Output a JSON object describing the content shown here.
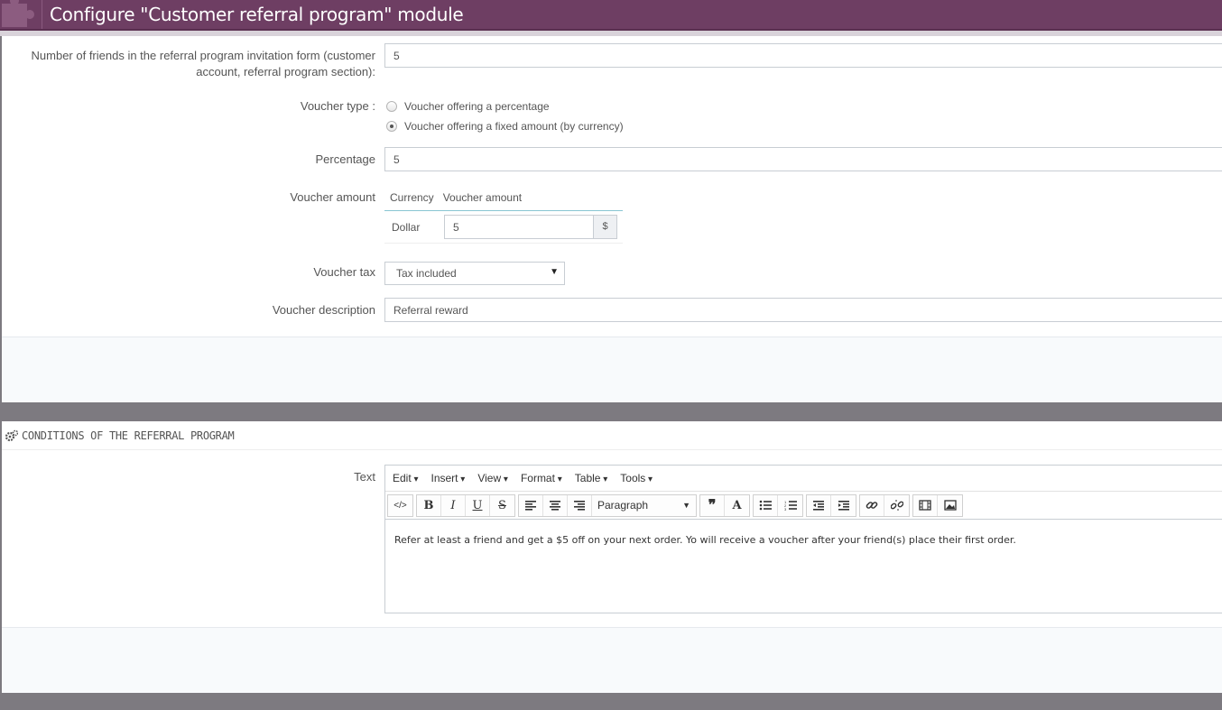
{
  "header": {
    "title": "Configure \"Customer referral program\" module"
  },
  "form": {
    "friends_label": "Number of friends in the referral program invitation form (customer account, referral program section):",
    "friends_label_line1": "Number of friends in the referral program invitation form (customer",
    "friends_label_line2": "account, referral program section):",
    "friends_value": "5",
    "voucher_type_label": "Voucher type :",
    "voucher_type_options": [
      "Voucher offering a percentage",
      "Voucher offering a fixed amount (by currency)"
    ],
    "voucher_type_selected": "Voucher offering a fixed amount (by currency)",
    "percentage_label": "Percentage",
    "percentage_value": "5",
    "voucher_amount_label": "Voucher amount",
    "amount_table": {
      "headers": [
        "Currency",
        "Voucher amount"
      ],
      "rows": [
        {
          "currency": "Dollar",
          "amount": "5",
          "symbol": "$"
        }
      ]
    },
    "voucher_tax_label": "Voucher tax",
    "voucher_tax_value": "Tax included",
    "voucher_description_label": "Voucher description",
    "voucher_description_value": "Referral reward"
  },
  "conditions": {
    "heading": "CONDITIONS OF THE REFERRAL PROGRAM",
    "text_label": "Text",
    "menu": [
      "Edit",
      "Insert",
      "View",
      "Format",
      "Table",
      "Tools"
    ],
    "format_select": "Paragraph",
    "content": "Refer at least a friend and get a $5 off on your next order. Yo will receive a voucher after your friend(s) place their first order."
  },
  "colors": {
    "header_bg": "#6e3e63",
    "page_bg": "#7d7a80",
    "table_rule": "#88c5d3"
  },
  "icons": [
    "puzzle-icon",
    "gears-icon",
    "source-code-icon",
    "bold-icon",
    "italic-icon",
    "underline-icon",
    "strikethrough-icon",
    "align-left-icon",
    "align-center-icon",
    "align-right-icon",
    "blockquote-icon",
    "text-color-icon",
    "bullet-list-icon",
    "numbered-list-icon",
    "outdent-icon",
    "indent-icon",
    "link-icon",
    "unlink-icon",
    "media-icon",
    "image-icon"
  ]
}
